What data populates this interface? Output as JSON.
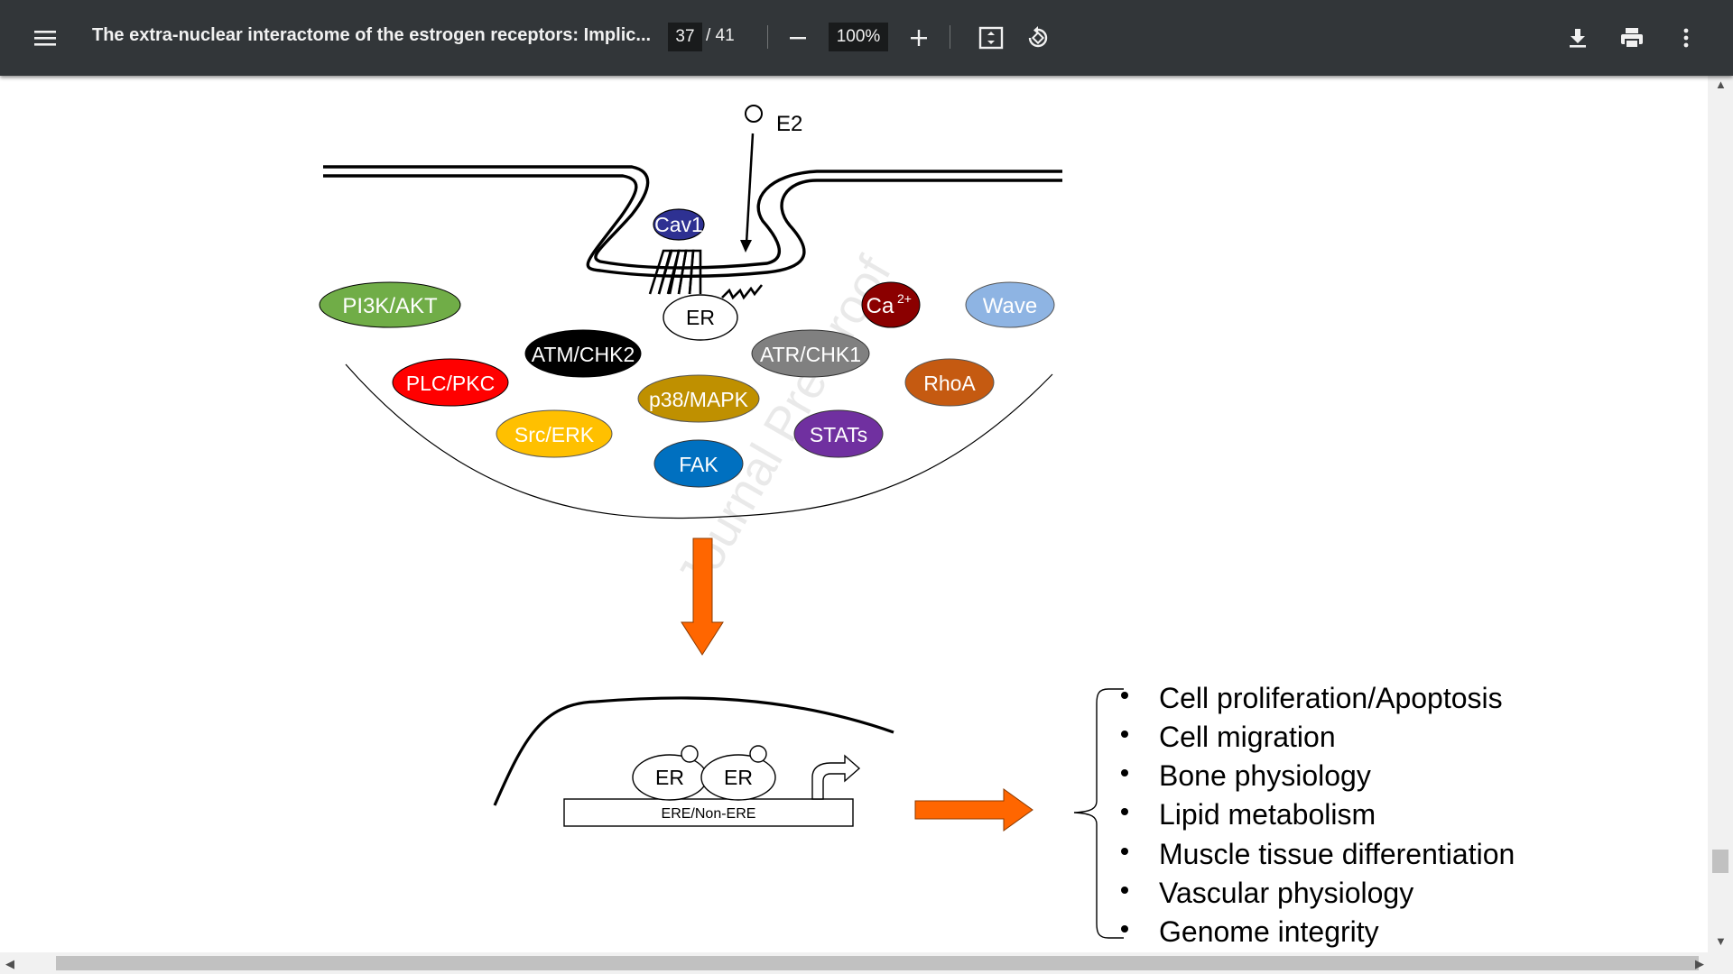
{
  "toolbar": {
    "title": "The extra-nuclear interactome of the estrogen receptors: Implic...",
    "current_page": "37",
    "page_total": "/ 41",
    "zoom": "100%",
    "menu_icon": "menu-icon",
    "download_icon": "download-icon",
    "print_icon": "print-icon",
    "more_icon": "more-vert-icon"
  },
  "figure": {
    "ligand": "E2",
    "membrane_protein": "Cav1",
    "receptor": "ER",
    "kinases": [
      {
        "label": "PI3K/AKT",
        "color": "#70ad47"
      },
      {
        "label": "ATM/CHK2",
        "color": "#000000"
      },
      {
        "label": "ATR/CHK1",
        "color": "#808080"
      },
      {
        "label": "Ca",
        "sup": "2+",
        "color": "#8b0000"
      },
      {
        "label": "Wave",
        "color": "#8eb4e3"
      },
      {
        "label": "PLC/PKC",
        "color": "#ff0000"
      },
      {
        "label": "p38/MAPK",
        "color": "#bf9000"
      },
      {
        "label": "RhoA",
        "color": "#c55a11"
      },
      {
        "label": "Src/ERK",
        "color": "#ffc000"
      },
      {
        "label": "STATs",
        "color": "#7030a0"
      },
      {
        "label": "FAK",
        "color": "#0070c0"
      }
    ],
    "nucleus_er_left": "ER",
    "nucleus_er_right": "ER",
    "dna_label": "ERE/Non-ERE",
    "arrow_color": "#ff6600",
    "outcomes": [
      "Cell proliferation/Apoptosis",
      "Cell migration",
      "Bone physiology",
      "Lipid metabolism",
      "Muscle tissue differentiation",
      "Vascular physiology",
      "Genome integrity"
    ],
    "watermark": "Journal Pre-proof"
  }
}
